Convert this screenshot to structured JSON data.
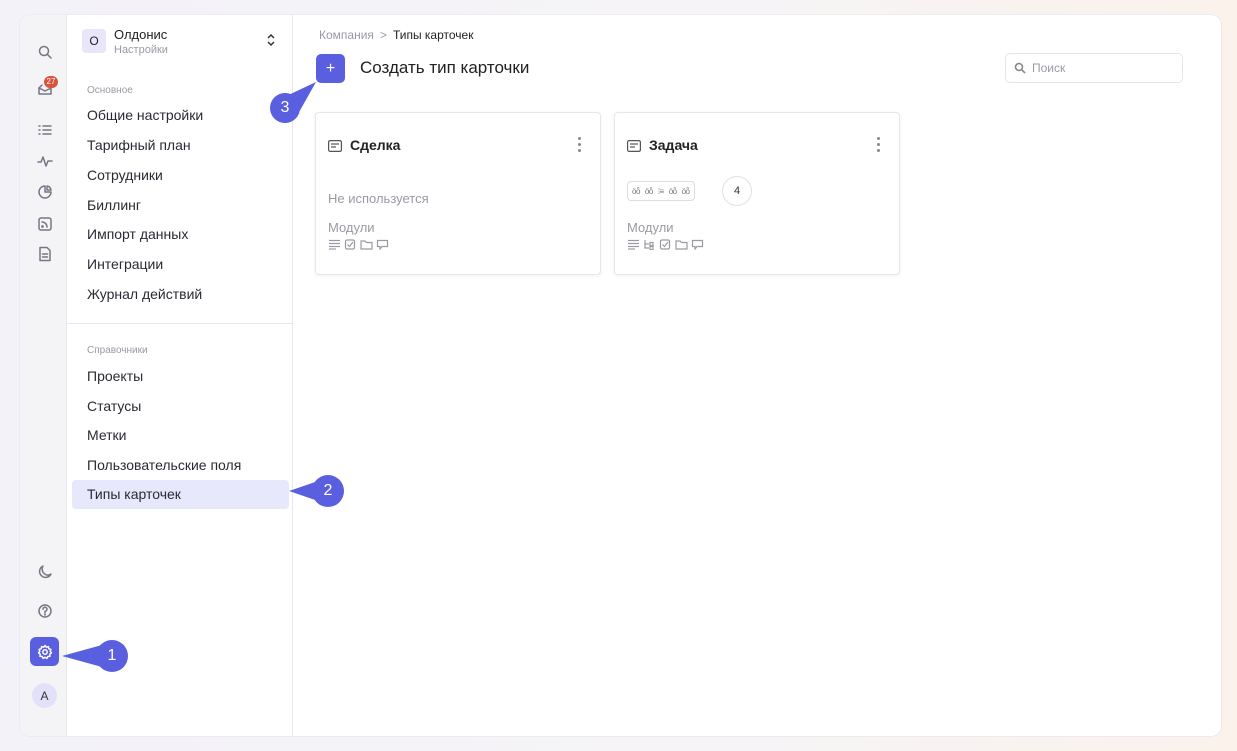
{
  "rail": {
    "inbox_badge": "27",
    "icons": [
      "search-icon",
      "inbox-icon",
      "list-icon",
      "activity-icon",
      "chart-icon",
      "rss-icon",
      "document-icon",
      "moon-icon",
      "help-icon",
      "gear-icon"
    ],
    "avatar_letter": "A"
  },
  "org": {
    "logo_letter": "O",
    "name": "Олдонис",
    "subtitle": "Настройки"
  },
  "sidebar": {
    "section_main": "Основное",
    "main_items": [
      "Общие настройки",
      "Тарифный план",
      "Сотрудники",
      "Биллинг",
      "Импорт данных",
      "Интеграции",
      "Журнал действий"
    ],
    "section_refs": "Справочники",
    "ref_items": [
      "Проекты",
      "Статусы",
      "Метки",
      "Пользовательские поля",
      "Типы карточек"
    ],
    "active_item": "Типы карточек"
  },
  "breadcrumb": {
    "parent": "Компания",
    "separator": ">",
    "current": "Типы карточек"
  },
  "toolbar": {
    "create_icon": "+",
    "create_label": "Создать тип карточки",
    "search_placeholder": "Поиск"
  },
  "cards": [
    {
      "title": "Сделка",
      "status": "Не используется",
      "modules_label": "Модули",
      "module_icons": [
        "description-icon",
        "checklist-icon",
        "folder-icon",
        "comment-icon"
      ]
    },
    {
      "title": "Задача",
      "field_chips": [
        "ӧȫ",
        "ӧȫ",
        "⁞≡",
        "ӧȫ",
        "ӧȫ"
      ],
      "field_count": "4",
      "modules_label": "Модули",
      "module_icons": [
        "description-icon",
        "subtasks-icon",
        "checklist-icon",
        "folder-icon",
        "comment-icon"
      ]
    }
  ],
  "callouts": [
    "1",
    "2",
    "3"
  ],
  "colors": {
    "accent": "#5a5fe0",
    "badge": "#d9533b",
    "active_bg": "#e7e8fb"
  }
}
